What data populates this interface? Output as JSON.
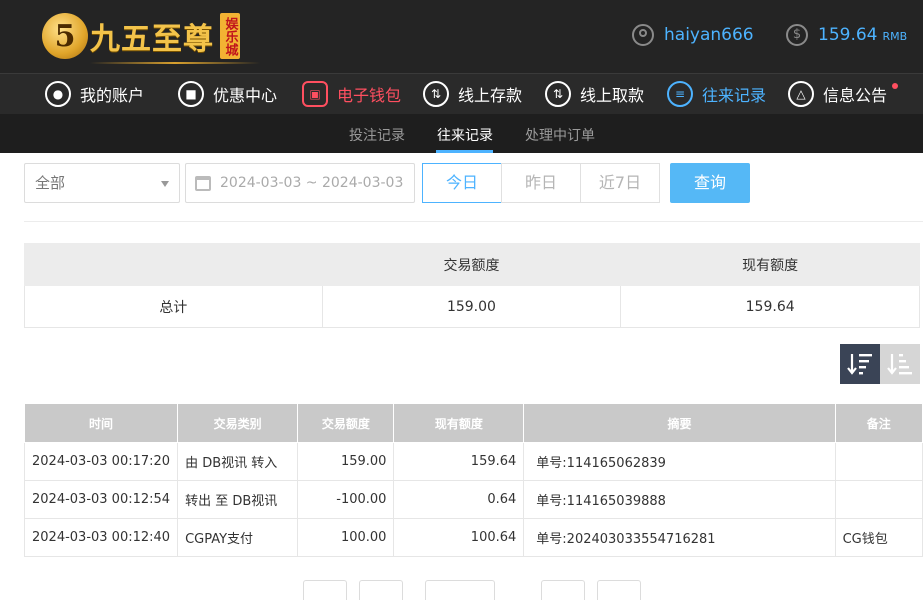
{
  "brand": {
    "mark": "5",
    "name": "九五至尊",
    "tag": "娱乐城"
  },
  "user": {
    "username": "haiyan666",
    "balance": "159.64",
    "balance_unit": "RMB"
  },
  "nav": {
    "items": [
      {
        "label": "我的账户",
        "icon": "user-icon"
      },
      {
        "label": "优惠中心",
        "icon": "gift-icon"
      },
      {
        "label": "电子钱包",
        "icon": "wallet-icon"
      },
      {
        "label": "线上存款",
        "icon": "deposit-icon"
      },
      {
        "label": "线上取款",
        "icon": "withdraw-icon"
      },
      {
        "label": "往来记录",
        "icon": "records-icon"
      },
      {
        "label": "信息公告",
        "icon": "bell-icon"
      }
    ]
  },
  "subnav": {
    "items": [
      "投注记录",
      "往来记录",
      "处理中订单"
    ],
    "active": "往来记录"
  },
  "filters": {
    "type_value": "全部",
    "date_range": "2024-03-03 ~ 2024-03-03",
    "quick": [
      "今日",
      "昨日",
      "近7日"
    ],
    "quick_active": "今日",
    "search_label": "查询"
  },
  "summary": {
    "headers": [
      "",
      "交易额度",
      "现有额度"
    ],
    "row": [
      "总计",
      "159.00",
      "159.64"
    ]
  },
  "records": {
    "headers": [
      "时间",
      "交易类别",
      "交易额度",
      "现有额度",
      "摘要",
      "备注"
    ],
    "rows": [
      [
        "2024-03-03 00:17:20",
        "由 DB视讯 转入",
        "159.00",
        "159.64",
        "单号:114165062839",
        ""
      ],
      [
        "2024-03-03 00:12:54",
        "转出 至 DB视讯",
        "-100.00",
        "0.64",
        "单号:114165039888",
        ""
      ],
      [
        "2024-03-03 00:12:40",
        "CGPAY支付",
        "100.00",
        "100.64",
        "单号:202403033554716281",
        "CG钱包"
      ]
    ]
  },
  "colors": {
    "accent_blue": "#4db3ff",
    "accent_red": "#ff4f60",
    "gold": "#f3c34a",
    "header_bg": "#242424"
  }
}
